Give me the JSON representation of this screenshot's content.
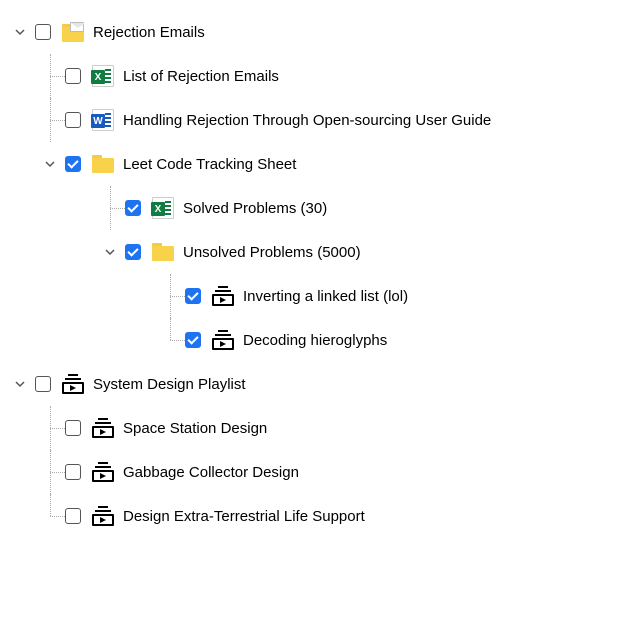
{
  "tree": [
    {
      "id": "rejection",
      "indent": 0,
      "chevron": "down",
      "checked": false,
      "icon": "mail-folder",
      "label": "Rejection Emails",
      "lines": []
    },
    {
      "id": "list-rejection",
      "indent": 2,
      "chevron": "none",
      "checked": false,
      "icon": "excel",
      "label": "List of Rejection Emails",
      "lines": [
        {
          "i": 1,
          "v": true,
          "h": true
        }
      ]
    },
    {
      "id": "handling-rejection",
      "indent": 2,
      "chevron": "none",
      "checked": false,
      "icon": "word",
      "label": "Handling Rejection Through Open-sourcing User Guide",
      "lines": [
        {
          "i": 1,
          "v": true,
          "h": true
        }
      ]
    },
    {
      "id": "leetcode",
      "indent": 2,
      "chevron": "down",
      "checked": true,
      "icon": "folder",
      "label": "Leet Code Tracking Sheet",
      "lines": [
        {
          "i": 1,
          "v": true,
          "half": true
        }
      ],
      "chevronAt": 1
    },
    {
      "id": "solved",
      "indent": 4,
      "chevron": "none",
      "checked": true,
      "icon": "excel",
      "label": "Solved Problems (30)",
      "lines": [
        {
          "i": 3,
          "v": true,
          "h": true
        }
      ]
    },
    {
      "id": "unsolved",
      "indent": 4,
      "chevron": "down",
      "checked": true,
      "icon": "folder",
      "label": "Unsolved Problems (5000)",
      "lines": [
        {
          "i": 3,
          "v": true,
          "half": true
        }
      ],
      "chevronAt": 3
    },
    {
      "id": "inverting",
      "indent": 6,
      "chevron": "none",
      "checked": true,
      "icon": "playlist",
      "label": "Inverting a linked list (lol)",
      "lines": [
        {
          "i": 5,
          "v": true,
          "h": true
        }
      ]
    },
    {
      "id": "decoding",
      "indent": 6,
      "chevron": "none",
      "checked": true,
      "icon": "playlist",
      "label": "Decoding hieroglyphs",
      "lines": [
        {
          "i": 5,
          "v": true,
          "h": true,
          "half": true
        }
      ]
    },
    {
      "id": "sysdesign",
      "indent": 0,
      "chevron": "down",
      "checked": false,
      "icon": "playlist",
      "label": "System Design Playlist",
      "lines": []
    },
    {
      "id": "space-station",
      "indent": 2,
      "chevron": "none",
      "checked": false,
      "icon": "playlist",
      "label": "Space Station Design",
      "lines": [
        {
          "i": 1,
          "v": true,
          "h": true
        }
      ]
    },
    {
      "id": "garbage-collector",
      "indent": 2,
      "chevron": "none",
      "checked": false,
      "icon": "playlist",
      "label": "Gabbage Collector Design",
      "lines": [
        {
          "i": 1,
          "v": true,
          "h": true
        }
      ]
    },
    {
      "id": "et-life",
      "indent": 2,
      "chevron": "none",
      "checked": false,
      "icon": "playlist",
      "label": "Design Extra-Terrestrial Life Support",
      "lines": [
        {
          "i": 1,
          "v": true,
          "h": true,
          "half": true
        }
      ]
    }
  ],
  "office_badges": {
    "excel": "X",
    "word": "W"
  }
}
